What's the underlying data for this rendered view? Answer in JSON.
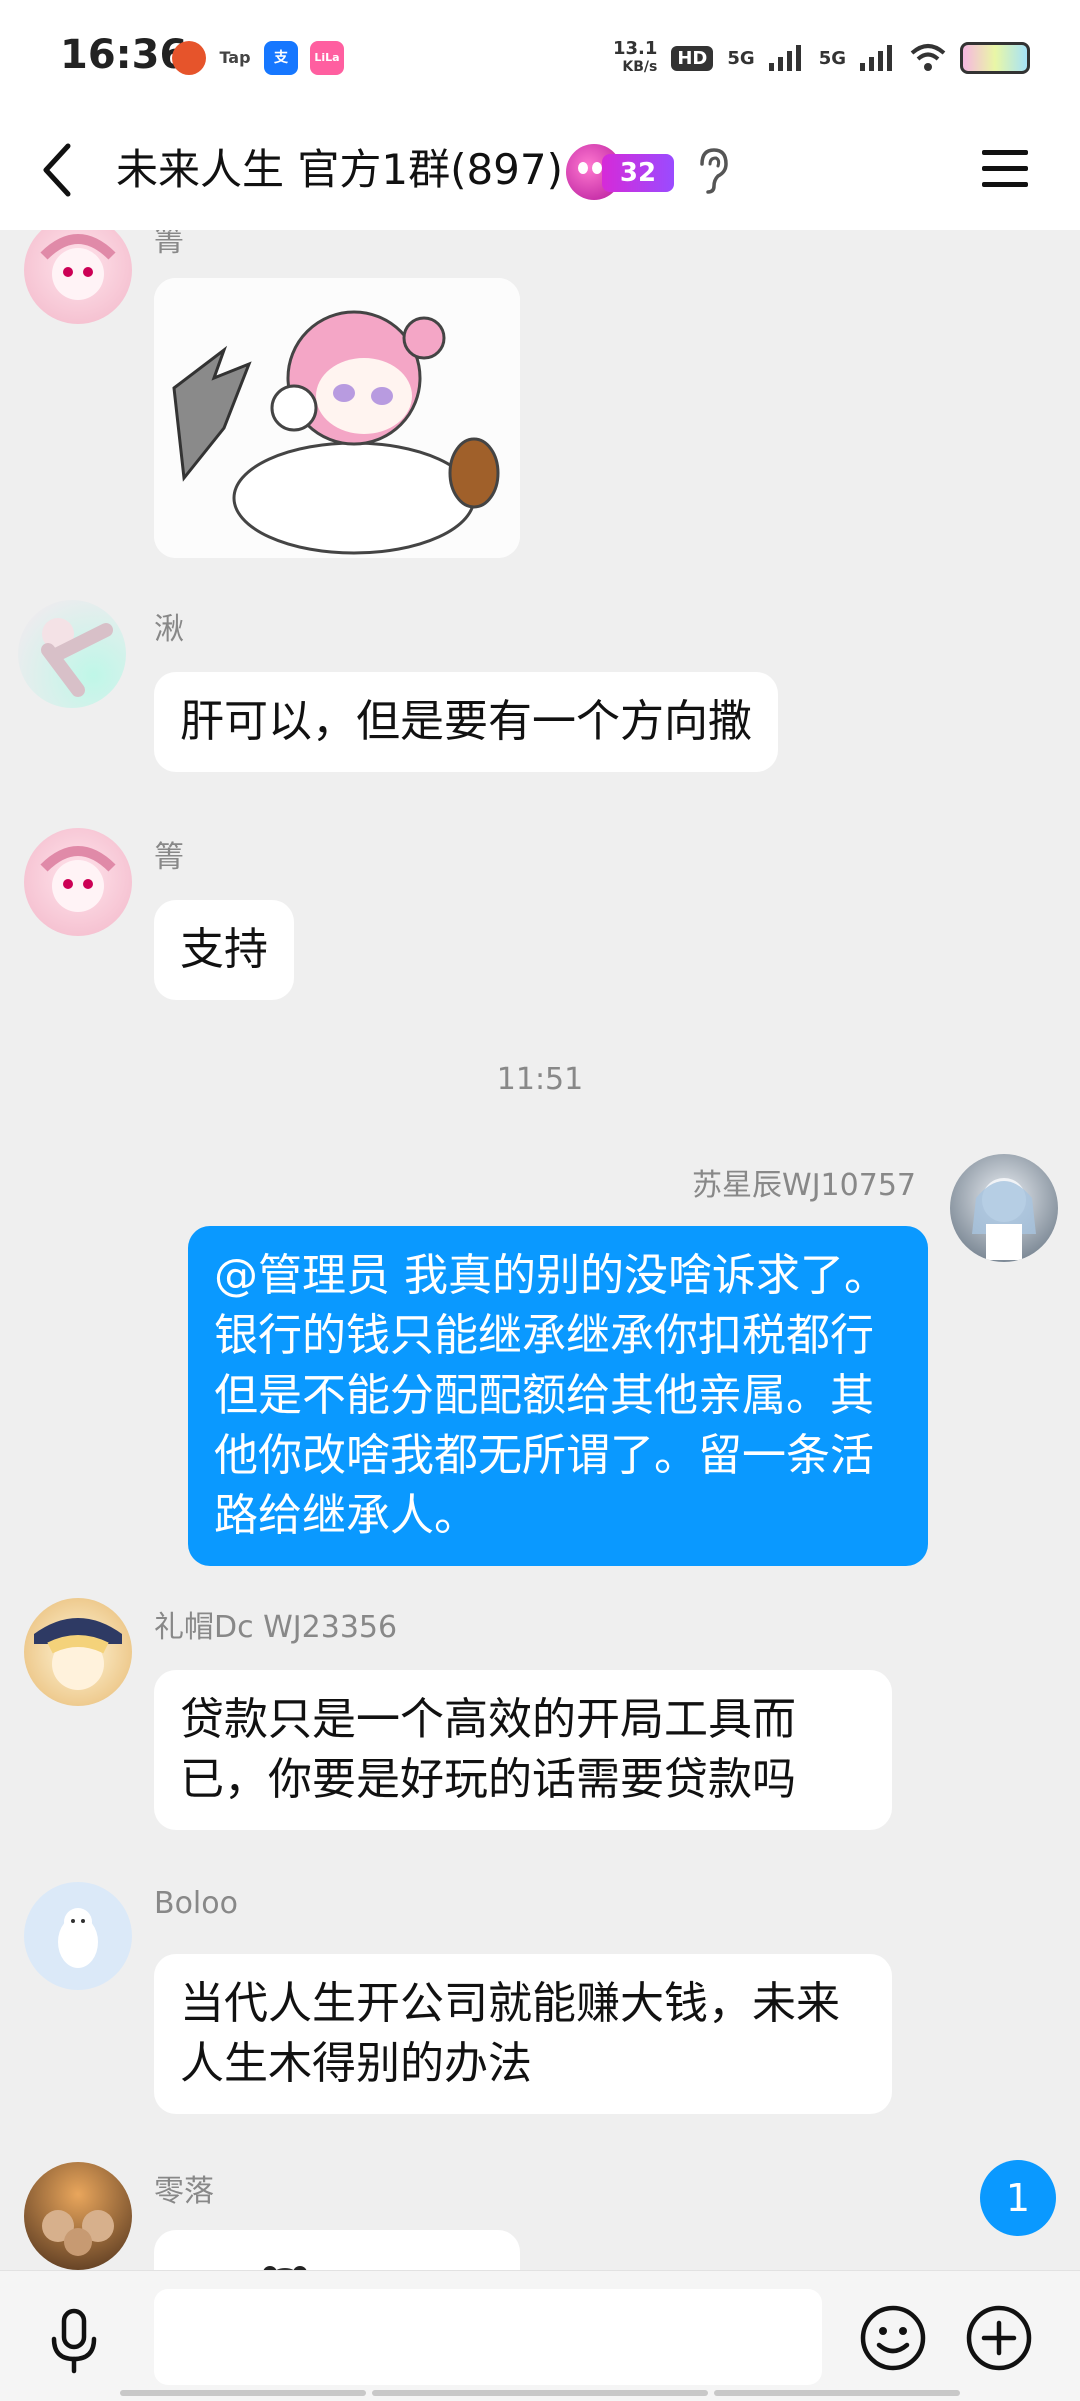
{
  "status_bar": {
    "time": "16:36",
    "app_icons": [
      "Tap",
      "支",
      "LiLa"
    ],
    "net_speed_value": "13.1",
    "net_speed_unit": "KB/s",
    "hd_label": "HD",
    "signal_1": "5G",
    "signal_2": "5G"
  },
  "header": {
    "title": "未来人生 官方1群(897)",
    "badge_count": "32"
  },
  "messages": [
    {
      "sender": "箐",
      "type": "sticker"
    },
    {
      "sender": "湫",
      "text": "肝可以，但是要有一个方向撒"
    },
    {
      "sender": "箐",
      "text": "支持"
    },
    {
      "timestamp": "11:51"
    },
    {
      "sender": "苏星辰WJ10757",
      "text": "@管理员 我真的别的没啥诉求了。银行的钱只能继承继承你扣税都行但是不能分配配额给其他亲属。其他你改啥我都无所谓了。留一条活路给继承人。"
    },
    {
      "sender": "礼帽Dc WJ23356",
      "text": "贷款只是一个高效的开局工具而已，你要是好玩的话需要贷款吗"
    },
    {
      "sender": "Boloo",
      "text": "当代人生开公司就能赚大钱，未来人生木得别的办法"
    },
    {
      "sender": "零落",
      "text": "。。。"
    }
  ],
  "unread_count": "1",
  "input": {
    "placeholder": ""
  },
  "colors": {
    "accent": "#0a99ff",
    "background": "#efefef"
  }
}
